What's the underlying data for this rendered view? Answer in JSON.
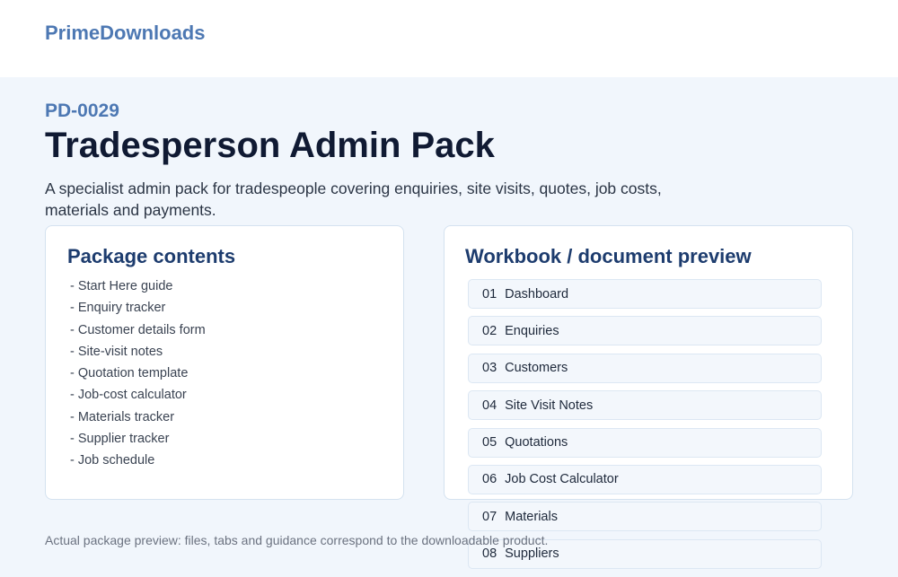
{
  "header": {
    "brand": "PrimeDownloads"
  },
  "product": {
    "code": "PD-0029",
    "title": "Tradesperson Admin Pack",
    "description": "A specialist admin pack for tradespeople covering enquiries, site visits, quotes, job costs, materials and payments."
  },
  "package_contents": {
    "heading": "Package contents",
    "items": [
      "- Start Here guide",
      "- Enquiry tracker",
      "- Customer details form",
      "- Site-visit notes",
      "- Quotation template",
      "- Job-cost calculator",
      "- Materials tracker",
      "- Supplier tracker",
      "- Job schedule"
    ]
  },
  "preview": {
    "heading": "Workbook / document preview",
    "sheets": [
      {
        "num": "01",
        "name": "Dashboard"
      },
      {
        "num": "02",
        "name": "Enquiries"
      },
      {
        "num": "03",
        "name": "Customers"
      },
      {
        "num": "04",
        "name": "Site Visit Notes"
      },
      {
        "num": "05",
        "name": "Quotations"
      },
      {
        "num": "06",
        "name": "Job Cost Calculator"
      },
      {
        "num": "07",
        "name": "Materials"
      },
      {
        "num": "08",
        "name": "Suppliers"
      }
    ]
  },
  "footnote": "Actual package preview: files, tabs and guidance correspond to the downloadable product."
}
